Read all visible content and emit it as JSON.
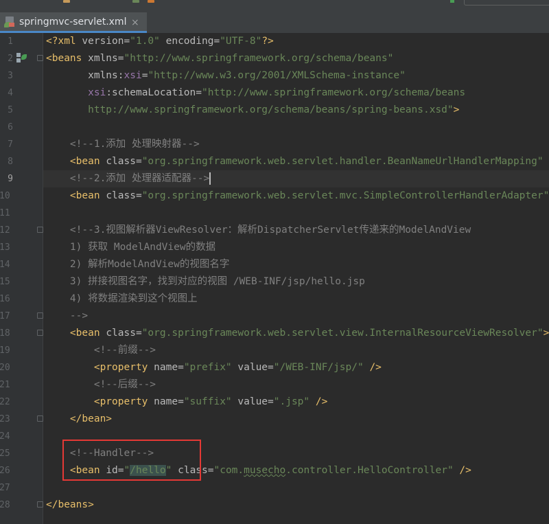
{
  "tabs": [
    {
      "label": "springmvc-servlet.xml",
      "active": true,
      "close_glyph": "×"
    }
  ],
  "colors": {
    "editor_bg": "#2b2b2b",
    "gutter_bg": "#313335",
    "xml_tag": "#e8bf6a",
    "string": "#6a8759",
    "comment": "#808080",
    "namespace": "#9876aa",
    "highlight_box": "#e53935"
  },
  "editor": {
    "current_line": 9,
    "lines": [
      {
        "n": "1",
        "tokens": [
          [
            "tag",
            "<?xml "
          ],
          [
            "attr",
            "version="
          ],
          [
            "str",
            "\"1.0\""
          ],
          [
            "attr",
            " encoding="
          ],
          [
            "str",
            "\"UTF-8\""
          ],
          [
            "tag",
            "?>"
          ]
        ]
      },
      {
        "n": "2",
        "tokens": [
          [
            "tag",
            "<beans "
          ],
          [
            "attr",
            "xmlns="
          ],
          [
            "str",
            "\"http://www.springframework.org/schema/beans\""
          ]
        ]
      },
      {
        "n": "3",
        "tokens": [
          [
            "txt",
            "       "
          ],
          [
            "attr",
            "xmlns:"
          ],
          [
            "ns",
            "xsi"
          ],
          [
            "attr",
            "="
          ],
          [
            "str",
            "\"http://www.w3.org/2001/XMLSchema-instance\""
          ]
        ]
      },
      {
        "n": "4",
        "tokens": [
          [
            "txt",
            "       "
          ],
          [
            "ns",
            "xsi"
          ],
          [
            "attr",
            ":schemaLocation="
          ],
          [
            "str",
            "\"http://www.springframework.org/schema/beans"
          ]
        ]
      },
      {
        "n": "5",
        "tokens": [
          [
            "txt",
            "       "
          ],
          [
            "str",
            "http://www.springframework.org/schema/beans/spring-beans.xsd\""
          ],
          [
            "tag",
            ">"
          ]
        ]
      },
      {
        "n": "6",
        "tokens": []
      },
      {
        "n": "7",
        "tokens": [
          [
            "txt",
            "    "
          ],
          [
            "com",
            "<!--1.添加 处理映射器-->"
          ]
        ]
      },
      {
        "n": "8",
        "tokens": [
          [
            "txt",
            "    "
          ],
          [
            "tag",
            "<bean "
          ],
          [
            "attr",
            "class="
          ],
          [
            "str",
            "\"org.springframework.web.servlet.handler.BeanNameUrlHandlerMapping\""
          ]
        ]
      },
      {
        "n": "9",
        "tokens": [
          [
            "txt",
            "    "
          ],
          [
            "com",
            "<!--2.添加 处理器适配器-->"
          ]
        ]
      },
      {
        "n": "10",
        "tokens": [
          [
            "txt",
            "    "
          ],
          [
            "tag",
            "<bean "
          ],
          [
            "attr",
            "class="
          ],
          [
            "str",
            "\"org.springframework.web.servlet.mvc.SimpleControllerHandlerAdapter\""
          ]
        ]
      },
      {
        "n": "11",
        "tokens": []
      },
      {
        "n": "12",
        "tokens": [
          [
            "txt",
            "    "
          ],
          [
            "com",
            "<!--3.视图解析器ViewResolver：解析DispatcherServlet传递来的ModelAndView"
          ]
        ]
      },
      {
        "n": "13",
        "tokens": [
          [
            "txt",
            "    "
          ],
          [
            "com",
            "1) 获取 ModelAndView的数据"
          ]
        ]
      },
      {
        "n": "14",
        "tokens": [
          [
            "txt",
            "    "
          ],
          [
            "com",
            "2) 解析ModelAndView的视图名字"
          ]
        ]
      },
      {
        "n": "15",
        "tokens": [
          [
            "txt",
            "    "
          ],
          [
            "com",
            "3) 拼接视图名字，找到对应的视图 /WEB-INF/jsp/hello.jsp"
          ]
        ]
      },
      {
        "n": "16",
        "tokens": [
          [
            "txt",
            "    "
          ],
          [
            "com",
            "4) 将数据渲染到这个视图上"
          ]
        ]
      },
      {
        "n": "17",
        "tokens": [
          [
            "txt",
            "    "
          ],
          [
            "com",
            "-->"
          ]
        ]
      },
      {
        "n": "18",
        "tokens": [
          [
            "txt",
            "    "
          ],
          [
            "tag",
            "<bean "
          ],
          [
            "attr",
            "class="
          ],
          [
            "str",
            "\"org.springframework.web.servlet.view.InternalResourceViewResolver\""
          ],
          [
            "tag",
            ">"
          ]
        ]
      },
      {
        "n": "19",
        "tokens": [
          [
            "txt",
            "        "
          ],
          [
            "com",
            "<!--前缀-->"
          ]
        ]
      },
      {
        "n": "20",
        "tokens": [
          [
            "txt",
            "        "
          ],
          [
            "tag",
            "<property "
          ],
          [
            "attr",
            "name="
          ],
          [
            "str",
            "\"prefix\""
          ],
          [
            "attr",
            " value="
          ],
          [
            "str",
            "\"/WEB-INF/jsp/\""
          ],
          [
            "tag",
            " />"
          ]
        ]
      },
      {
        "n": "21",
        "tokens": [
          [
            "txt",
            "        "
          ],
          [
            "com",
            "<!--后缀-->"
          ]
        ]
      },
      {
        "n": "22",
        "tokens": [
          [
            "txt",
            "        "
          ],
          [
            "tag",
            "<property "
          ],
          [
            "attr",
            "name="
          ],
          [
            "str",
            "\"suffix\""
          ],
          [
            "attr",
            " value="
          ],
          [
            "str",
            "\".jsp\""
          ],
          [
            "tag",
            " />"
          ]
        ]
      },
      {
        "n": "23",
        "tokens": [
          [
            "txt",
            "    "
          ],
          [
            "tag",
            "</bean>"
          ]
        ]
      },
      {
        "n": "24",
        "tokens": []
      },
      {
        "n": "25",
        "tokens": [
          [
            "txt",
            "    "
          ],
          [
            "com",
            "<!--Handler-->"
          ]
        ]
      },
      {
        "n": "26",
        "tokens": [
          [
            "txt",
            "    "
          ],
          [
            "tag",
            "<bean "
          ],
          [
            "attr",
            "id="
          ],
          [
            "str",
            "\""
          ],
          [
            "strhl",
            "/hello"
          ],
          [
            "str",
            "\""
          ],
          [
            "attr",
            " class="
          ],
          [
            "str",
            "\"com."
          ],
          [
            "strwav",
            "musecho"
          ],
          [
            "str",
            ".controller.HelloController\""
          ],
          [
            "tag",
            " />"
          ]
        ]
      },
      {
        "n": "27",
        "tokens": []
      },
      {
        "n": "28",
        "tokens": [
          [
            "tag",
            "</beans>"
          ]
        ]
      }
    ]
  }
}
